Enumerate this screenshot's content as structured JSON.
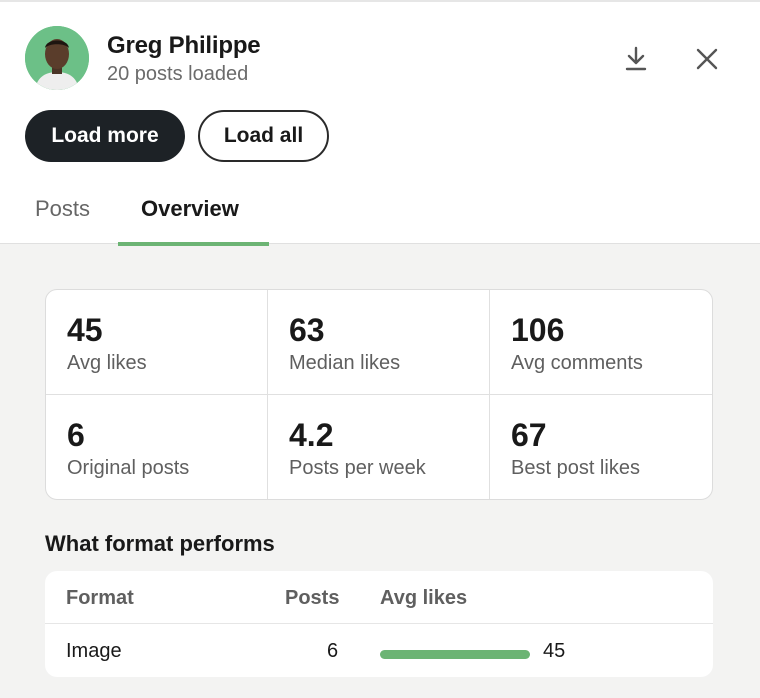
{
  "user": {
    "name": "Greg Philippe",
    "subtitle": "20 posts loaded"
  },
  "icons": {
    "download": "download-icon",
    "close": "close-icon",
    "avatar": "avatar-photo"
  },
  "actions": {
    "load_more": "Load more",
    "load_all": "Load all"
  },
  "tabs": [
    {
      "label": "Posts",
      "active": false
    },
    {
      "label": "Overview",
      "active": true
    }
  ],
  "stats": [
    {
      "value": "45",
      "label": "Avg likes"
    },
    {
      "value": "63",
      "label": "Median likes"
    },
    {
      "value": "106",
      "label": "Avg comments"
    },
    {
      "value": "6",
      "label": "Original posts"
    },
    {
      "value": "4.2",
      "label": "Posts per week"
    },
    {
      "value": "67",
      "label": "Best post likes"
    }
  ],
  "format_section": {
    "title": "What format performs",
    "headers": {
      "format": "Format",
      "posts": "Posts",
      "avg_likes": "Avg likes"
    },
    "rows": [
      {
        "format": "Image",
        "posts": "6",
        "avg_likes": "45",
        "bar_fraction": 1.0
      }
    ]
  },
  "colors": {
    "accent": "#6cb474",
    "primary_button": "#1d2226",
    "background": "#f3f3f2"
  }
}
